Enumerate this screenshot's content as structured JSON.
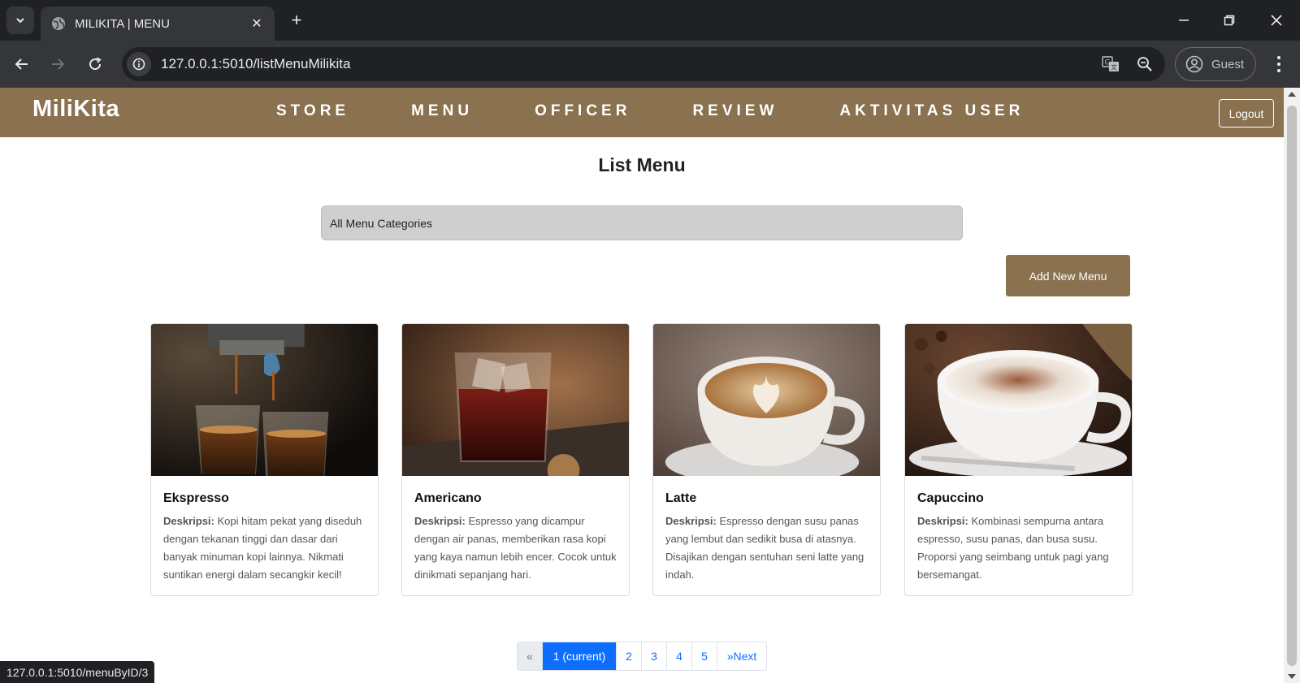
{
  "browser": {
    "tab_title": "MILIKITA | MENU",
    "url": "127.0.0.1:5010/listMenuMilikita",
    "profile_label": "Guest",
    "status_url": "127.0.0.1:5010/menuByID/3"
  },
  "site": {
    "brand": "MiliKita",
    "nav": [
      "STORE",
      "MENU",
      "OFFICER",
      "REVIEW",
      "AKTIVITAS USER"
    ],
    "logout_label": "Logout",
    "brand_color": "#8a7150"
  },
  "page": {
    "title": "List Menu",
    "category_select": "All Menu Categories",
    "add_button": "Add New Menu"
  },
  "desc_label": "Deskripsi:",
  "menu_items": [
    {
      "name": "Ekspresso",
      "description": "Kopi hitam pekat yang diseduh dengan tekanan tinggi dan dasar dari banyak minuman kopi lainnya. Nikmati suntikan energi dalam secangkir kecil!"
    },
    {
      "name": "Americano",
      "description": "Espresso yang dicampur dengan air panas, memberikan rasa kopi yang kaya namun lebih encer. Cocok untuk dinikmati sepanjang hari."
    },
    {
      "name": "Latte",
      "description": "Espresso dengan susu panas yang lembut dan sedikit busa di atasnya. Disajikan dengan sentuhan seni latte yang indah."
    },
    {
      "name": "Capuccino",
      "description": "Kombinasi sempurna antara espresso, susu panas, dan busa susu. Proporsi yang seimbang untuk pagi yang bersemangat."
    }
  ],
  "pagination": {
    "prev": "«",
    "current": "1 (current)",
    "pages": [
      "2",
      "3",
      "4",
      "5"
    ],
    "next": "»Next"
  }
}
